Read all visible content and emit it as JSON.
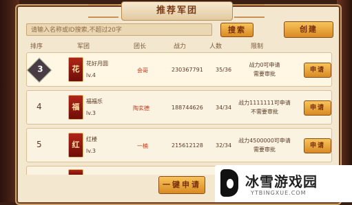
{
  "window": {
    "title": "推荐军团"
  },
  "search": {
    "placeholder": "请输入名称或ID搜索,不超过20字",
    "button": "搜索"
  },
  "create_button": "创建",
  "columns": [
    "排序",
    "军团",
    "团长",
    "战力",
    "人数",
    "限制"
  ],
  "rows": [
    {
      "rank": "3",
      "emblem_char": "花",
      "name": "花好月圆",
      "level": "lv.4",
      "leader": "会哥",
      "power": "230367791",
      "members": "35/36",
      "limit_line1": "战力0可申请",
      "limit_line2": "需要审批",
      "apply": "申请"
    },
    {
      "rank": "4",
      "emblem_char": "福",
      "name": "福福乐",
      "level": "lv.3",
      "leader": "陶玄德",
      "power": "188744626",
      "members": "34/34",
      "limit_line1": "战力1111111可申请",
      "limit_line2": "不需要审批",
      "apply": "申请"
    },
    {
      "rank": "5",
      "emblem_char": "红",
      "name": "红楼",
      "level": "lv.3",
      "leader": "一楠",
      "power": "215612128",
      "members": "32/34",
      "limit_line1": "战力4500000可申请",
      "limit_line2": "需要审批",
      "apply": "申请"
    }
  ],
  "one_key_apply": "一键申请",
  "watermark": {
    "text": "冰雪游戏园",
    "url": "YTBINGXUE.COM"
  },
  "colors": {
    "accent_button": "#e8a33a",
    "panel": "#f3e7cf",
    "leader_text": "#c03a1a"
  }
}
